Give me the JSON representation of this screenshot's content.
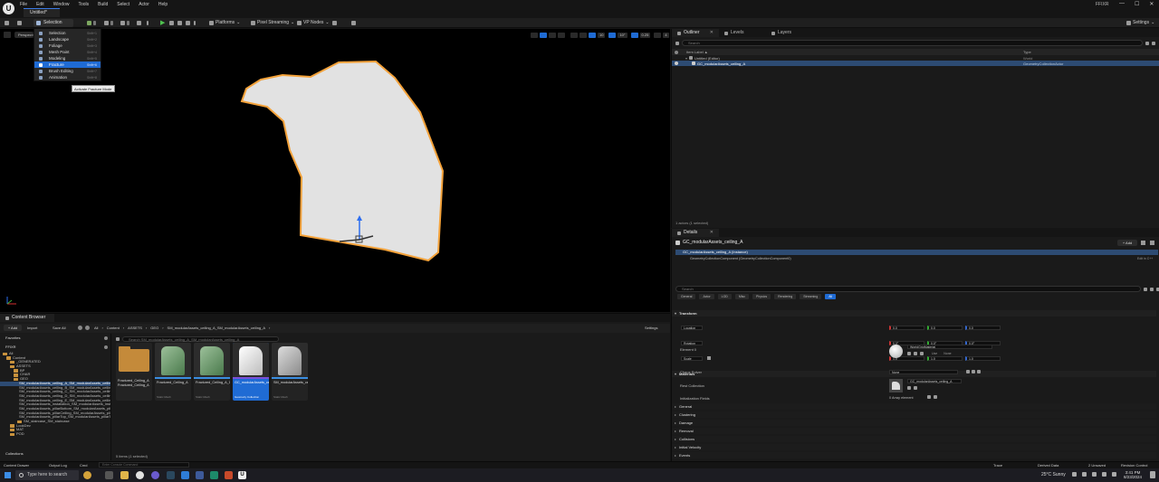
{
  "titlebar": {
    "app_name": "FFIXR",
    "document_tab": "Untitled*",
    "menu": [
      "File",
      "Edit",
      "Window",
      "Tools",
      "Build",
      "Select",
      "Actor",
      "Help"
    ],
    "controls": [
      "—",
      "☐",
      "✕"
    ]
  },
  "toolbar": {
    "selection_mode": "Selection Mode",
    "platforms": "Platforms",
    "pixel_streaming": "Pixel Streaming",
    "vp_nodes": "VP Nodes",
    "settings": "Settings"
  },
  "mode_menu": {
    "items": [
      {
        "label": "Selection",
        "shortcut": "Shift+1"
      },
      {
        "label": "Landscape",
        "shortcut": "Shift+2"
      },
      {
        "label": "Foliage",
        "shortcut": "Shift+3"
      },
      {
        "label": "Mesh Paint",
        "shortcut": "Shift+4"
      },
      {
        "label": "Modeling",
        "shortcut": "Shift+5"
      },
      {
        "label": "Fracture",
        "shortcut": "Shift+6"
      },
      {
        "label": "Brush Editing",
        "shortcut": "Shift+7"
      },
      {
        "label": "Animation",
        "shortcut": "Shift+8"
      }
    ],
    "active_index": 5
  },
  "tooltip": "Activate Fracture Mode",
  "viewport": {
    "perspective_label": "Perspective",
    "snap_values": [
      "10",
      "10°",
      "0.25",
      "4"
    ],
    "active_tool": "translate"
  },
  "outliner": {
    "tabs": [
      "Outliner",
      "Levels",
      "Layers"
    ],
    "search_placeholder": "Search",
    "col_label": "Item Label ▲",
    "col_type": "Type",
    "rows": [
      {
        "label": "Untitled (Editor)",
        "type": "World"
      },
      {
        "label": "GC_modularAssets_ceiling_A",
        "type": "GeometryCollectionActor"
      }
    ],
    "footer": "1 actors (1 selected)"
  },
  "details": {
    "tab": "Details",
    "actor_name": "GC_modularAssets_ceiling_A",
    "add_label": "+ Add",
    "instance_row": "GC_modularAssets_ceiling_A (Instance)",
    "component_row": "GeometryCollectionComponent (GeometryCollectionComponent0)",
    "edit_in_cpp": "Edit in C++",
    "search_placeholder": "Search",
    "filters": [
      "General",
      "Actor",
      "LOD",
      "Misc",
      "Physics",
      "Rendering",
      "Streaming",
      "All"
    ],
    "transform": {
      "section": "Transform",
      "location_label": "Location",
      "rotation_label": "Rotation",
      "scale_label": "Scale",
      "location": [
        "0.0",
        "0.0",
        "0.0"
      ],
      "rotation": [
        "0.0°",
        "0.0°",
        "0.0°"
      ],
      "scale": [
        "1.0",
        "1.0",
        "1.0"
      ]
    },
    "materials": {
      "section": "Materials",
      "element": "Element 0",
      "material": "WorldGridMaterial",
      "use": "Use",
      "source": "None"
    },
    "chaos_physics": {
      "section": "Chaos Physics",
      "solver_label": "Chaos Solver",
      "solver_value": "None",
      "rest_label": "Rest Collection",
      "rest_value": "GC_modularAssets_ceiling_A",
      "init_fields_label": "Initialization Fields",
      "init_fields_value": "0 Array element"
    },
    "collapsed_sections": [
      "General",
      "Clustering",
      "Damage",
      "Removal",
      "Collisions",
      "Initial Velocity",
      "Events"
    ]
  },
  "content_browser": {
    "tab": "Content Browser",
    "add": "+ Add",
    "import": "Import",
    "save_all": "Save All",
    "breadcrumb": [
      "All",
      "Content",
      "ASSETS",
      "GEO",
      "SM_modularAssets_ceiling_A_SM_modularAssets_ceiling_A"
    ],
    "settings": "Settings",
    "favorites": "Favorites",
    "project": "FFIXR",
    "search_placeholder": "Search SM_modularAssets_ceiling_A_SM_modularAssets_ceiling_A",
    "tree": [
      {
        "label": "All",
        "depth": 0,
        "selected": false
      },
      {
        "label": "Content",
        "depth": 1,
        "selected": false
      },
      {
        "label": "_GENERATED",
        "depth": 2,
        "selected": false
      },
      {
        "label": "ASSETS",
        "depth": 2,
        "selected": false
      },
      {
        "label": "BP",
        "depth": 3,
        "selected": false
      },
      {
        "label": "CHAR",
        "depth": 3,
        "selected": false
      },
      {
        "label": "GEO",
        "depth": 3,
        "selected": false
      },
      {
        "label": "SM_modularAssets_ceiling_A_SM_modularAssets_ceiling_A",
        "depth": 4,
        "selected": true
      },
      {
        "label": "SM_modularAssets_ceiling_B_SM_modularAssets_ceiling_B",
        "depth": 4,
        "selected": false
      },
      {
        "label": "SM_modularAssets_ceiling_C_SM_modularAssets_ceiling_C",
        "depth": 4,
        "selected": false
      },
      {
        "label": "SM_modularAssets_ceiling_D_SM_modularAssets_ceiling_D",
        "depth": 4,
        "selected": false
      },
      {
        "label": "SM_modularAssets_ceiling_E_SM_modularAssets_ceiling_E",
        "depth": 4,
        "selected": false
      },
      {
        "label": "SM_modularAssets_installation_SM_modularAssets_installation",
        "depth": 4,
        "selected": false
      },
      {
        "label": "SM_modularAssets_pillarBottom_SM_modularAssets_pillarBottom",
        "depth": 4,
        "selected": false
      },
      {
        "label": "SM_modularAssets_pillarCeiling_SM_modularAssets_pillarCeiling",
        "depth": 4,
        "selected": false
      },
      {
        "label": "SM_modularAssets_pillarTop_SM_modularAssets_pillarTop",
        "depth": 4,
        "selected": false
      },
      {
        "label": "SM_staircase_SM_staircase",
        "depth": 4,
        "selected": false
      },
      {
        "label": "LookDev",
        "depth": 2,
        "selected": false
      },
      {
        "label": "MAT",
        "depth": 2,
        "selected": false
      },
      {
        "label": "POD",
        "depth": 2,
        "selected": false
      }
    ],
    "collections": "Collections",
    "assets": [
      {
        "name": "Fractured_Ceiling_A Fractured_Ceiling_A",
        "type": "",
        "kind": "folder"
      },
      {
        "name": "Fractured_Ceiling_A",
        "type": "Static Mesh",
        "kind": "green"
      },
      {
        "name": "Fractured_Ceiling_A_1",
        "type": "Static Mesh",
        "kind": "green"
      },
      {
        "name": "GC_modularAssets_ceiling_A",
        "type": "Geometry Collection",
        "kind": "white"
      },
      {
        "name": "SM_modularAssets_ceiling_A_SM",
        "type": "Static Mesh",
        "kind": "gray"
      }
    ],
    "footer": "5 items (1 selected)"
  },
  "statusbar": {
    "content_drawer": "Content Drawer",
    "output_log": "Output Log",
    "cmd": "Cmd",
    "console_placeholder": "Enter Console Command",
    "trace": "Trace",
    "derived_data": "Derived Data",
    "unsaved": "2 Unsaved",
    "revision_control": "Revision Control"
  },
  "taskbar": {
    "search_placeholder": "Type here to search",
    "weather": "25°C  Sunny",
    "time": "3:41 PM",
    "date": "8/23/2024"
  }
}
